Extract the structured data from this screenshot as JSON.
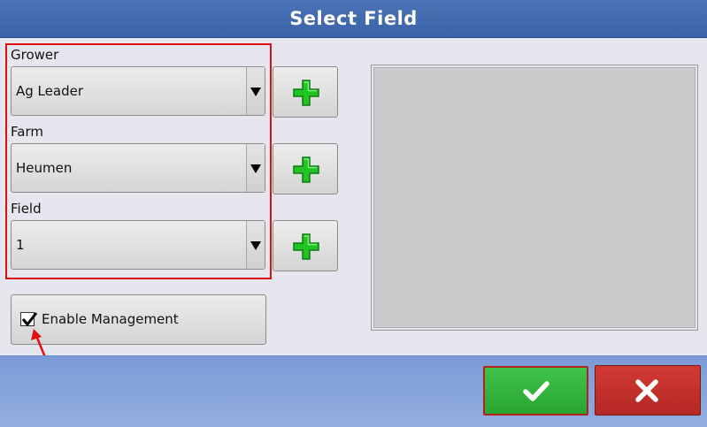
{
  "dialog": {
    "title": "Select Field"
  },
  "form": {
    "grower": {
      "label": "Grower",
      "value": "Ag Leader"
    },
    "farm": {
      "label": "Farm",
      "value": "Heumen"
    },
    "field": {
      "label": "Field",
      "value": "1"
    },
    "enable_management": {
      "label": "Enable Management",
      "checked": true
    }
  },
  "icons": {
    "add": "plus-icon",
    "dropdown": "triangle-down-icon",
    "confirm": "checkmark-icon",
    "cancel": "x-icon"
  },
  "colors": {
    "title_bar": "#3f67ab",
    "add_plus": "#22c422",
    "ok_button": "#33b53c",
    "cancel_button": "#c2302c",
    "highlight_frame": "#e01010",
    "annotation_arrow": "#e01010"
  }
}
